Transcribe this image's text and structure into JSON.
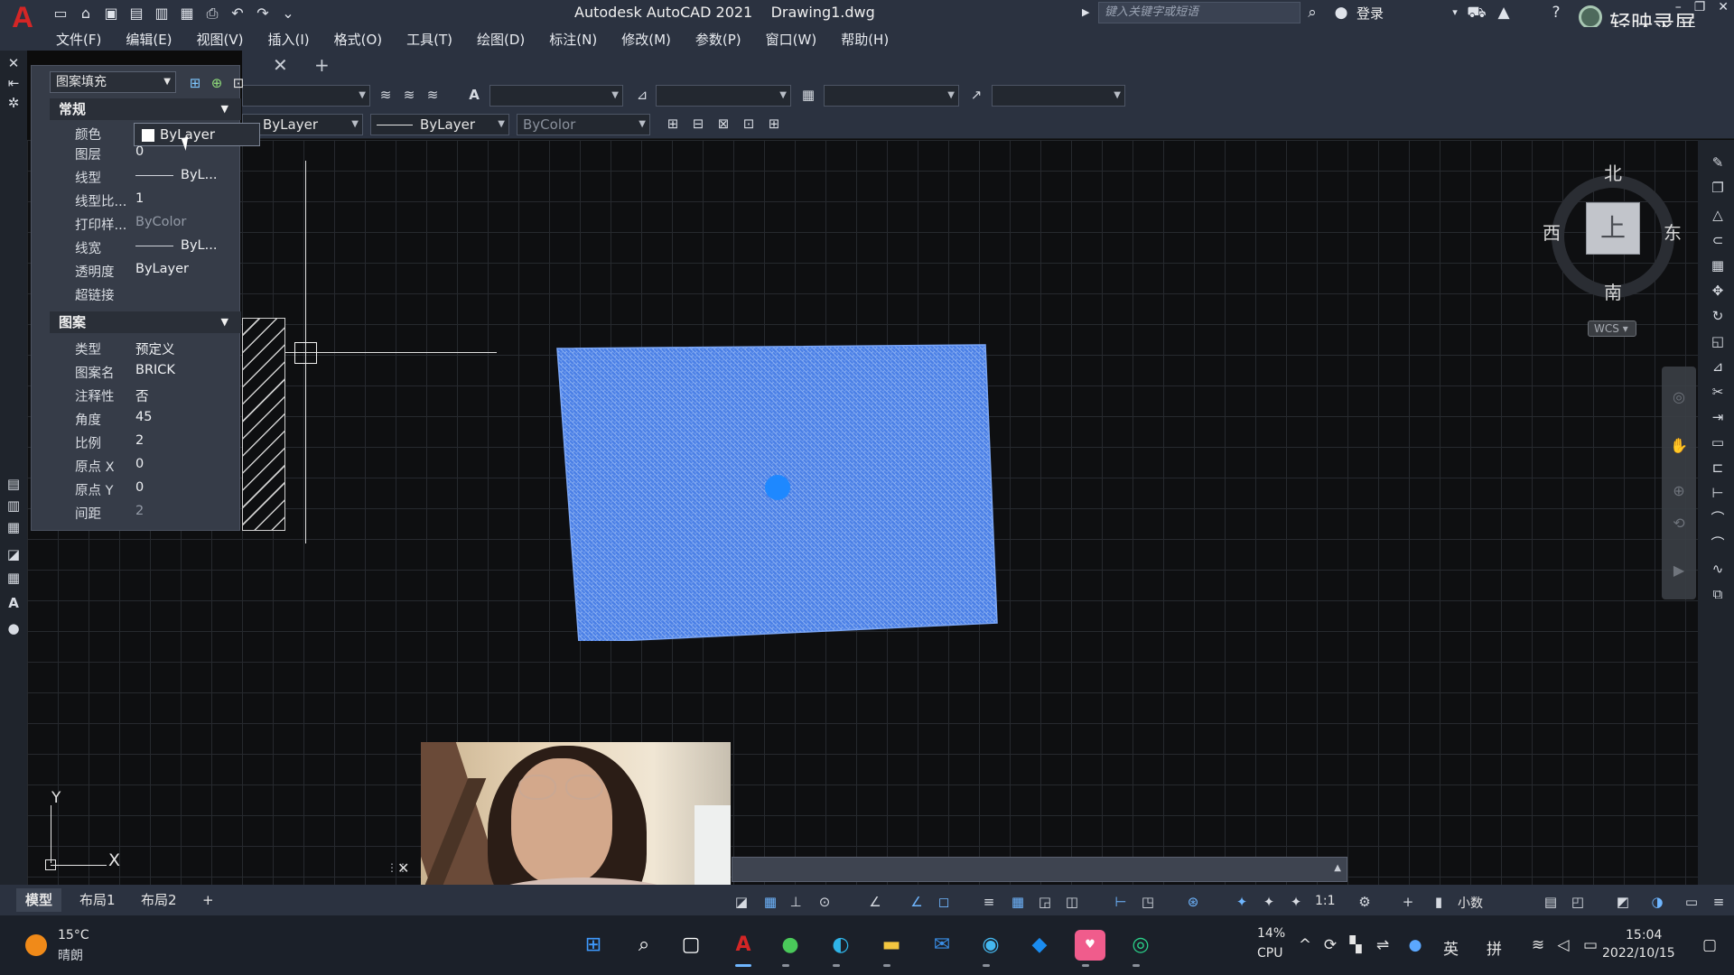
{
  "titlebar": {
    "app_title": "Autodesk AutoCAD 2021",
    "filename": "Drawing1.dwg",
    "search_placeholder": "键入关键字或短语",
    "login": "登录",
    "recorder_brand": "轻映录屏"
  },
  "menu": [
    "文件(F)",
    "编辑(E)",
    "视图(V)",
    "插入(I)",
    "格式(O)",
    "工具(T)",
    "绘图(D)",
    "标注(N)",
    "修改(M)",
    "参数(P)",
    "窗口(W)",
    "帮助(H)"
  ],
  "toolbar": {
    "linetype_1": "ByLayer",
    "linetype_2": "ByLayer",
    "plotstyle": "ByColor"
  },
  "properties": {
    "selector": "图案填充",
    "general_section": "常规",
    "general": [
      {
        "name": "颜色",
        "value": "ByLayer"
      },
      {
        "name": "图层",
        "value": "0"
      },
      {
        "name": "线型",
        "value": "ByL..."
      },
      {
        "name": "线型比...",
        "value": "1"
      },
      {
        "name": "打印样...",
        "value": "ByColor"
      },
      {
        "name": "线宽",
        "value": "ByL..."
      },
      {
        "name": "透明度",
        "value": "ByLayer"
      },
      {
        "name": "超链接",
        "value": ""
      }
    ],
    "pattern_section": "图案",
    "pattern": [
      {
        "name": "类型",
        "value": "预定义"
      },
      {
        "name": "图案名",
        "value": "BRICK"
      },
      {
        "name": "注释性",
        "value": "否"
      },
      {
        "name": "角度",
        "value": "45"
      },
      {
        "name": "比例",
        "value": "2"
      },
      {
        "name": "原点 X",
        "value": "0"
      },
      {
        "name": "原点 Y",
        "value": "0"
      },
      {
        "name": "间距",
        "value": "2"
      }
    ]
  },
  "viewcube": {
    "north": "北",
    "south": "南",
    "west": "西",
    "east": "东",
    "face": "上",
    "wcs": "WCS"
  },
  "ucs": {
    "y": "Y",
    "x": "X"
  },
  "layout_tabs": [
    "模型",
    "布局1",
    "布局2"
  ],
  "status": {
    "scale": "1:1",
    "units": "小数"
  },
  "taskbar": {
    "temperature": "15°C",
    "weather": "晴朗",
    "cpu_percent": "14%",
    "cpu_label": "CPU",
    "ime_lang": "英",
    "ime_mode": "拼",
    "time": "15:04",
    "date": "2022/10/15"
  },
  "colors": {
    "accent_blue": "#3d78e0",
    "grip_blue": "#1e88ff",
    "hatch_blue": "#5a8ff0"
  }
}
